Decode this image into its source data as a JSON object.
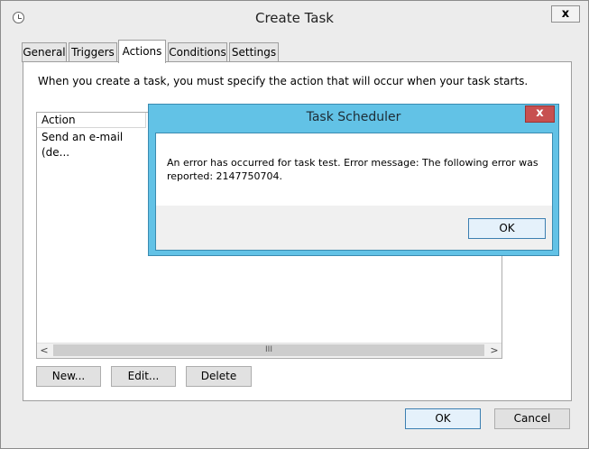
{
  "window": {
    "title": "Create Task",
    "close_glyph": "x",
    "icon": "clock-icon"
  },
  "tabs": [
    {
      "label": "General",
      "active": false
    },
    {
      "label": "Triggers",
      "active": false
    },
    {
      "label": "Actions",
      "active": true
    },
    {
      "label": "Conditions",
      "active": false
    },
    {
      "label": "Settings",
      "active": false
    }
  ],
  "actions_panel": {
    "instruction": "When you create a task, you must specify the action that will occur when your task starts.",
    "list": {
      "columns": [
        "Action"
      ],
      "rows": [
        [
          "Send an e-mail (de..."
        ]
      ],
      "scroll_grip": "III",
      "scroll_left": "<",
      "scroll_right": ">"
    },
    "buttons": {
      "new": "New...",
      "edit": "Edit...",
      "delete": "Delete"
    }
  },
  "footer": {
    "ok": "OK",
    "cancel": "Cancel"
  },
  "dialog": {
    "title": "Task Scheduler",
    "close_glyph": "x",
    "message_line1": "An error has occurred for task test. Error message: The following error was",
    "message_line2": "reported: 2147750704.",
    "ok": "OK"
  },
  "colors": {
    "dialog_frame": "#62c2e6",
    "close_button": "#c75050",
    "window_background": "#ececec"
  }
}
